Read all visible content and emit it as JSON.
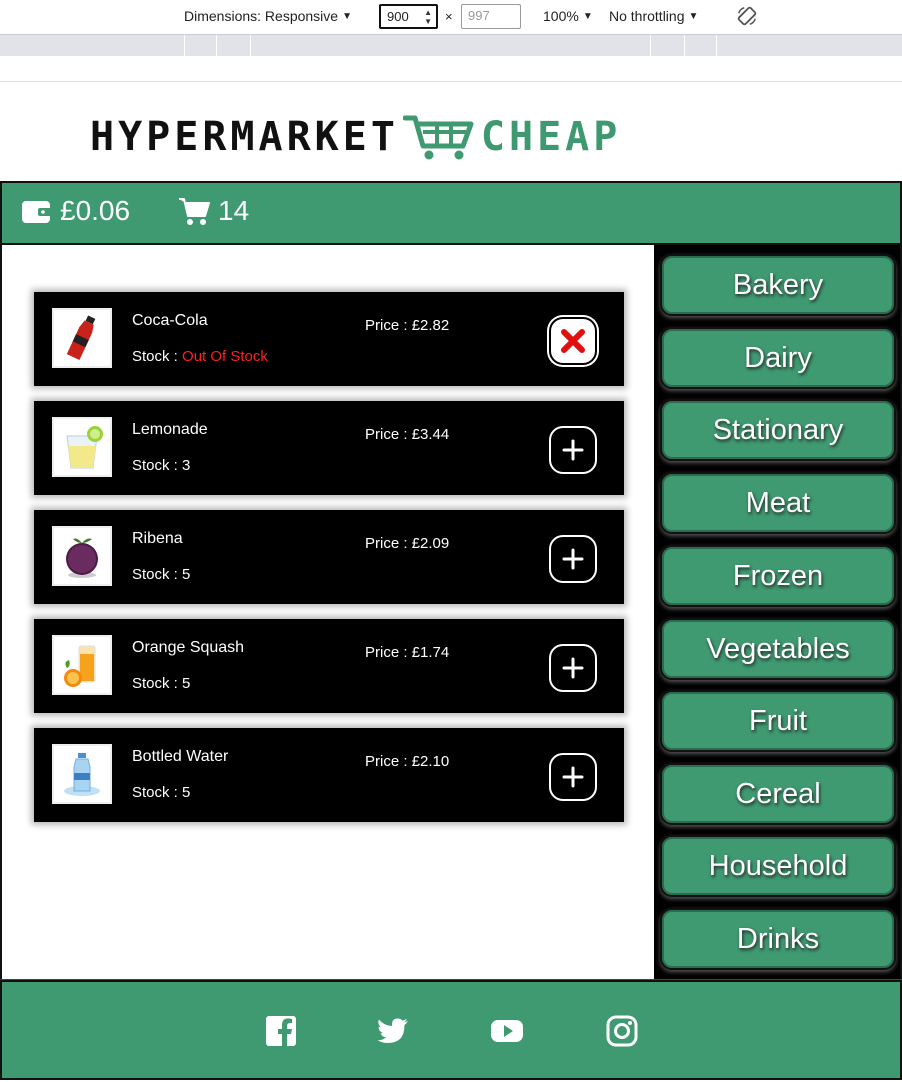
{
  "devtools": {
    "dimensions_label": "Dimensions: Responsive",
    "width_value": "900",
    "times": "×",
    "height_value": "997",
    "zoom": "100%",
    "throttling": "No throttling"
  },
  "brand": {
    "name_part1": "HYPERMARKET",
    "name_part2": "CHEAP",
    "cart_icon": "shopping-cart-icon",
    "colors": {
      "green": "#3f9a71",
      "dark": "#111111"
    }
  },
  "topbar": {
    "wallet_icon": "wallet-icon",
    "balance": "£0.06",
    "cart_icon": "cart-icon",
    "cart_count": "14"
  },
  "products": [
    {
      "name": "Coca-Cola",
      "stock_label": "Stock :",
      "stock_value": "Out Of Stock",
      "out_of_stock": true,
      "price_label": "Price :",
      "price": "£2.82",
      "action_icon": "close-icon"
    },
    {
      "name": "Lemonade",
      "stock_label": "Stock :",
      "stock_value": "3",
      "out_of_stock": false,
      "price_label": "Price :",
      "price": "£3.44",
      "action_icon": "plus-icon"
    },
    {
      "name": "Ribena",
      "stock_label": "Stock :",
      "stock_value": "5",
      "out_of_stock": false,
      "price_label": "Price :",
      "price": "£2.09",
      "action_icon": "plus-icon"
    },
    {
      "name": "Orange Squash",
      "stock_label": "Stock :",
      "stock_value": "5",
      "out_of_stock": false,
      "price_label": "Price :",
      "price": "£1.74",
      "action_icon": "plus-icon"
    },
    {
      "name": "Bottled Water",
      "stock_label": "Stock :",
      "stock_value": "5",
      "out_of_stock": false,
      "price_label": "Price :",
      "price": "£2.10",
      "action_icon": "plus-icon"
    }
  ],
  "categories": [
    "Bakery",
    "Dairy",
    "Stationary",
    "Meat",
    "Frozen",
    "Vegetables",
    "Fruit",
    "Cereal",
    "Household",
    "Drinks"
  ],
  "footer": {
    "social": [
      "facebook-icon",
      "twitter-icon",
      "youtube-icon",
      "instagram-icon"
    ]
  }
}
